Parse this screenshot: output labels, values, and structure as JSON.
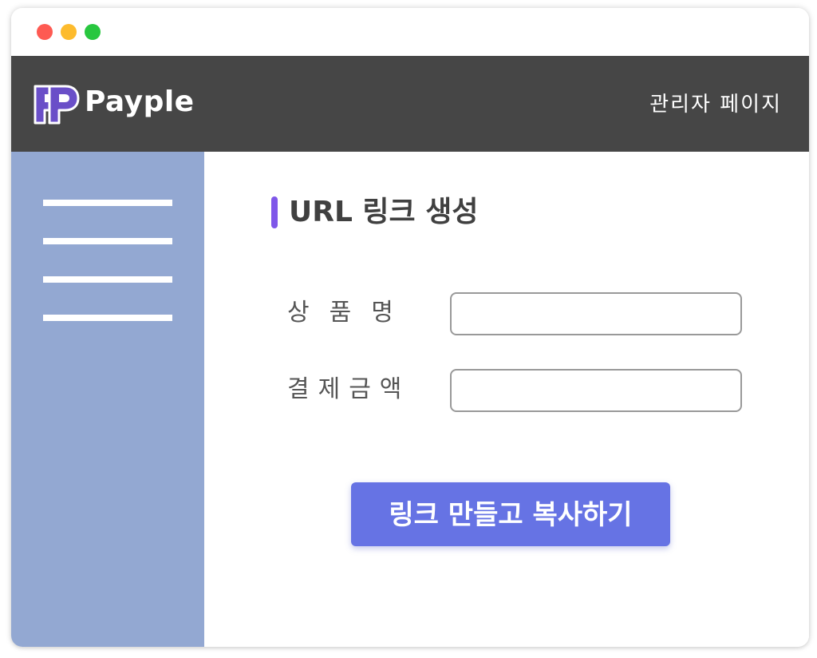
{
  "window": {
    "traffic_lights": [
      "close",
      "minimize",
      "maximize"
    ]
  },
  "header": {
    "logo_icon": "payple-pp-logo-icon",
    "brand_name": "Payple",
    "admin_link": "관리자 페이지"
  },
  "sidebar": {
    "menu_items": 4,
    "icon": "menu-lines"
  },
  "main": {
    "title": "URL 링크 생성",
    "fields": [
      {
        "label": "상품명",
        "value": "",
        "placeholder": ""
      },
      {
        "label": "결제금액",
        "value": "",
        "placeholder": ""
      }
    ],
    "submit_label": "링크 만들고 복사하기"
  },
  "colors": {
    "header_bg": "#464646",
    "sidebar_bg": "#93a8d2",
    "title_accent": "#7f57e9",
    "button_bg": "#6673e4",
    "logo_purple": "#6a4fc8"
  }
}
